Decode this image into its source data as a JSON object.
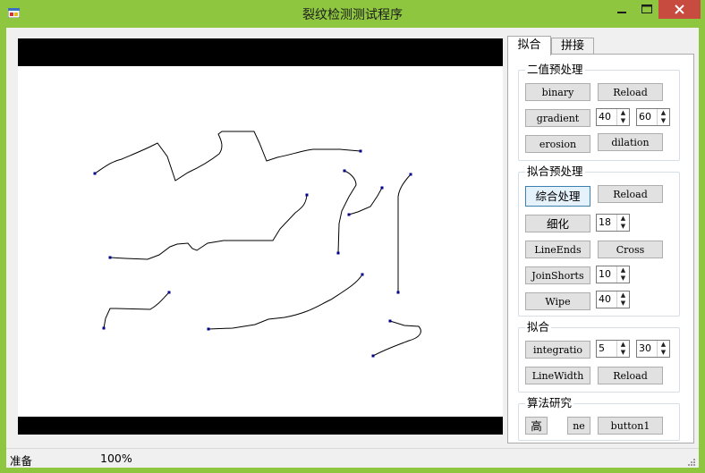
{
  "window": {
    "title": "裂纹检测测试程序",
    "accent": "#8ec63f",
    "close_color": "#c74b3e"
  },
  "icons": {
    "app": "app-icon",
    "minimize": "minimize-icon",
    "maximize": "maximize-icon",
    "close": "close-icon"
  },
  "tabs": [
    {
      "label": "拟合",
      "active": true
    },
    {
      "label": "拼接",
      "active": false
    }
  ],
  "groups": {
    "binary_pre": {
      "title": "二值预处理",
      "binary": "binary",
      "reload": "Reload",
      "gradient": "gradient",
      "grad_low": "40",
      "grad_high": "60",
      "erosion": "erosion",
      "dilation": "dilation"
    },
    "fit_pre": {
      "title": "拟合预处理",
      "combined": "综合处理",
      "reload": "Reload",
      "thin": "细化",
      "thin_val": "18",
      "lineends": "LineEnds",
      "cross": "Cross",
      "joinshorts": "JoinShorts",
      "join_val": "10",
      "wipe": "Wipe",
      "wipe_val": "40"
    },
    "fit": {
      "title": "拟合",
      "integration": "integratio",
      "int_a": "5",
      "int_b": "30",
      "linewidth": "LineWidth",
      "reload": "Reload"
    },
    "research": {
      "title": "算法研究",
      "high": "高",
      "ne": "ne",
      "button1": "button1"
    }
  },
  "status": {
    "ready": "准备",
    "zoom": "100%"
  },
  "crack_color": "#00008b"
}
